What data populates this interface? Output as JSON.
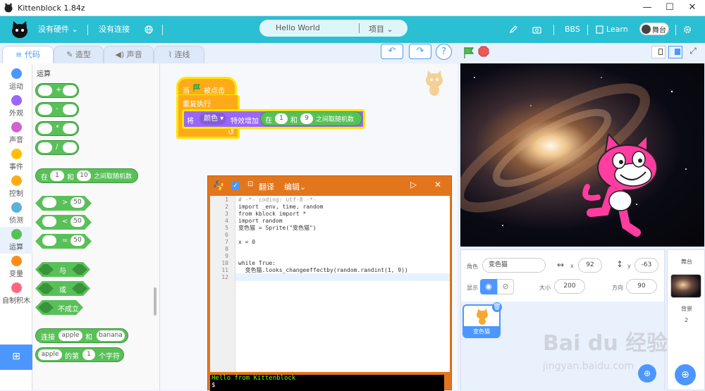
{
  "window": {
    "title": "Kittenblock 1.84z",
    "minimize": "—",
    "maximize": "☐",
    "close": "✕"
  },
  "menu": {
    "hardware": "没有硬件",
    "connect": "没有连接",
    "project_name": "Hello World",
    "project_menu": "项目",
    "bbs": "BBS",
    "learn": "Learn",
    "stage_toggle": "舞台"
  },
  "tabs": [
    {
      "label": "代码"
    },
    {
      "label": "造型"
    },
    {
      "label": "声音"
    },
    {
      "label": "连线"
    }
  ],
  "categories": [
    {
      "label": "运动",
      "color": "#4c97ff"
    },
    {
      "label": "外观",
      "color": "#9966ff"
    },
    {
      "label": "声音",
      "color": "#cf63cf"
    },
    {
      "label": "事件",
      "color": "#ffbf00"
    },
    {
      "label": "控制",
      "color": "#ffab19"
    },
    {
      "label": "侦测",
      "color": "#5cb1d6"
    },
    {
      "label": "运算",
      "color": "#59c059"
    },
    {
      "label": "变量",
      "color": "#ff8c1a"
    },
    {
      "label": "自制积木",
      "color": "#ff6680"
    }
  ],
  "palette": {
    "title": "运算",
    "arith": [
      "+",
      "-",
      "*",
      "/"
    ],
    "random": {
      "prefix": "在",
      "from": "1",
      "and": "和",
      "to": "10",
      "suffix": "之间取随机数"
    },
    "compare": [
      {
        "op": ">",
        "val": "50"
      },
      {
        "op": "<",
        "val": "50"
      },
      {
        "op": "=",
        "val": "50"
      }
    ],
    "logic": [
      "与",
      "或",
      "不成立"
    ],
    "join": {
      "prefix": "连接",
      "a": "apple",
      "and": "和",
      "b": "banana"
    },
    "letter": {
      "a": "apple",
      "of": "的第",
      "n": "1",
      "suffix": "个字符"
    }
  },
  "script": {
    "hat_when": "当",
    "hat_clicked": "被点击",
    "repeat": "重复执行",
    "set_label": "将",
    "effect": "颜色",
    "effect_label": "特效增加",
    "rand_prefix": "在",
    "rand_from": "1",
    "rand_and": "和",
    "rand_to": "9",
    "rand_suffix": "之间取随机数"
  },
  "python": {
    "translate": "翻译",
    "edit": "编辑",
    "lines": [
      {
        "n": "1",
        "code": "# -*- coding: utf-8 -*-"
      },
      {
        "n": "2",
        "code": "import _env, time, random"
      },
      {
        "n": "3",
        "code": "from kblock import *"
      },
      {
        "n": "4",
        "code": "import random"
      },
      {
        "n": "5",
        "code": "变色猫 = Sprite(\"变色猫\")"
      },
      {
        "n": "6",
        "code": ""
      },
      {
        "n": "7",
        "code": "x = 0"
      },
      {
        "n": "8",
        "code": ""
      },
      {
        "n": "9",
        "code": ""
      },
      {
        "n": "10",
        "code": "while True:"
      },
      {
        "n": "11",
        "code": "  变色猫.looks_changeeffectby(random.randint(1, 9))"
      },
      {
        "n": "12",
        "code": ""
      }
    ],
    "console": [
      "Hello from Kittenblock",
      "$"
    ]
  },
  "sprite_info": {
    "sprite_label": "角色",
    "sprite_name": "变色猫",
    "x_label": "x",
    "x": "92",
    "y_label": "y",
    "y": "-63",
    "show_label": "显示",
    "size_label": "大小",
    "size": "200",
    "dir_label": "方向",
    "dir": "90",
    "thumb_name": "变色猫"
  },
  "stage_panel": {
    "title": "舞台",
    "backdrop_label": "背景",
    "backdrop_count": "2"
  },
  "watermark": {
    "main": "Bai du 经验",
    "sub": "jingyan.baidu.com"
  },
  "colors": {
    "accent": "#2bbfd3",
    "blue": "#4c97ff",
    "operator": "#59c059",
    "control": "#ffab19",
    "python": "#e3761c"
  }
}
